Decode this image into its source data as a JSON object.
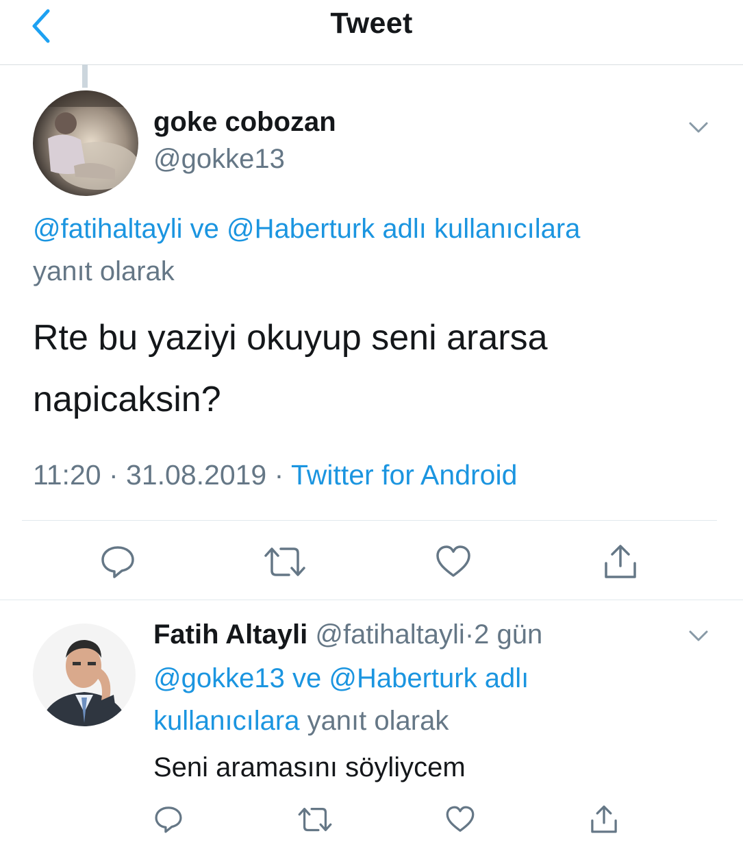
{
  "header": {
    "title": "Tweet",
    "back_icon": "chevron-left-icon",
    "accent": "#1da1f2"
  },
  "main_tweet": {
    "name": "goke cobozan",
    "handle": "@gokke13",
    "reply_to": {
      "mention_1": "@fatihaltayli",
      "connector": "ve",
      "mention_2": "@Haberturk",
      "suffix_link": "adlı kullanıcılara",
      "suffix_text": "yanıt olarak"
    },
    "text_line_1": "Rte bu yaziyi okuyup seni ararsa",
    "text_line_2": "napicaksin?",
    "time": "11:20",
    "separator": "·",
    "date": "31.08.2019",
    "source": "Twitter for Android"
  },
  "reply_tweet": {
    "name": "Fatih Altayli",
    "handle": "@fatihaltayli",
    "separator": "·",
    "age": "2 gün",
    "reply_to": {
      "mention_1": "@gokke13",
      "connector": "ve",
      "mention_2": "@Haberturk",
      "link_part_1": "adlı",
      "link_part_2": "kullanıcılara",
      "suffix_text": "yanıt olarak"
    },
    "text": "Seni aramasını söyliycem"
  },
  "colors": {
    "link": "#1b95e0",
    "secondary_text": "#657786",
    "primary_text": "#14171a",
    "divider": "#e1e8ed",
    "icon": "#657786"
  }
}
